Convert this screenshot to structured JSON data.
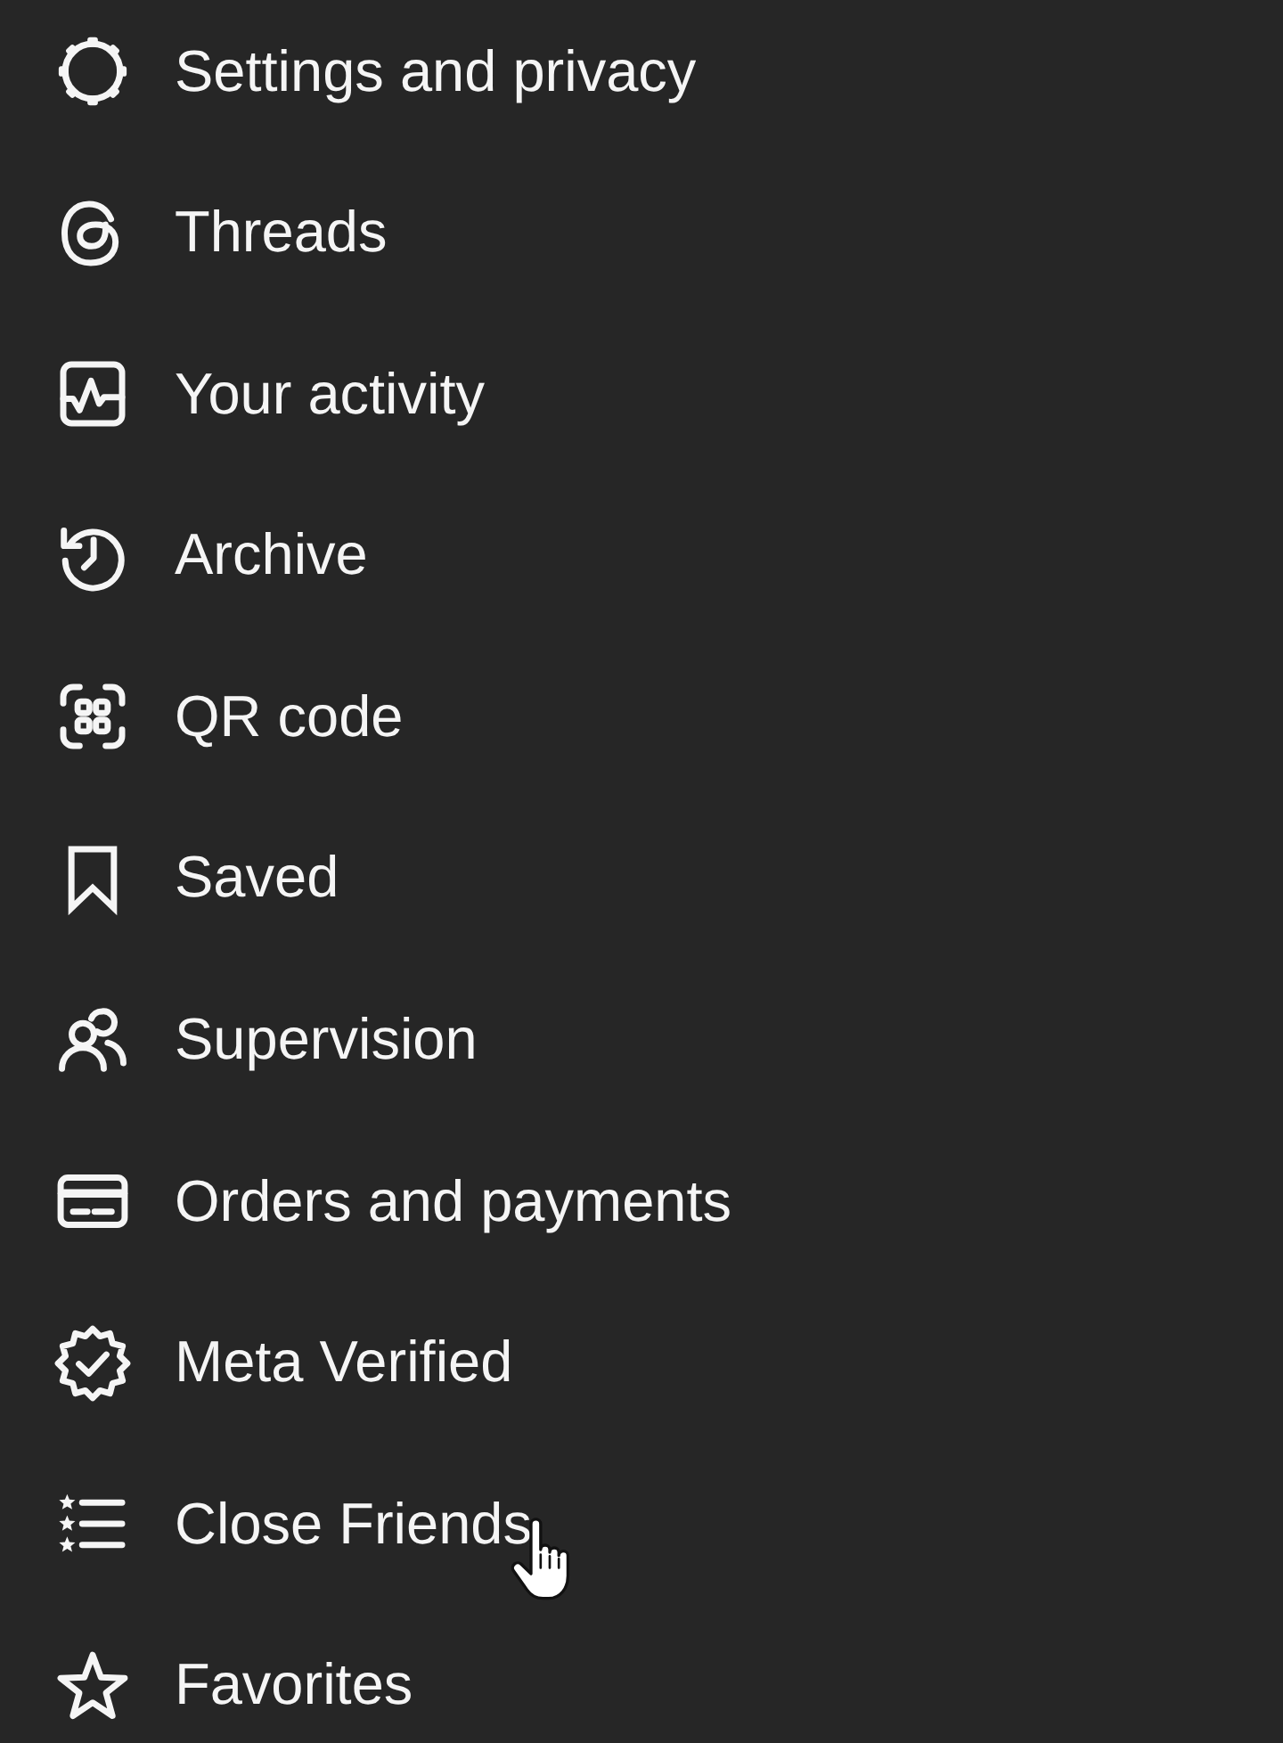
{
  "menu": {
    "items": [
      {
        "label": "Settings and privacy",
        "hovered": false
      },
      {
        "label": "Threads",
        "hovered": false
      },
      {
        "label": "Your activity",
        "hovered": false
      },
      {
        "label": "Archive",
        "hovered": false
      },
      {
        "label": "QR code",
        "hovered": false
      },
      {
        "label": "Saved",
        "hovered": false
      },
      {
        "label": "Supervision",
        "hovered": false
      },
      {
        "label": "Orders and payments",
        "hovered": false
      },
      {
        "label": "Meta Verified",
        "hovered": false
      },
      {
        "label": "Close Friends",
        "hovered": true
      },
      {
        "label": "Favorites",
        "hovered": false
      }
    ]
  }
}
